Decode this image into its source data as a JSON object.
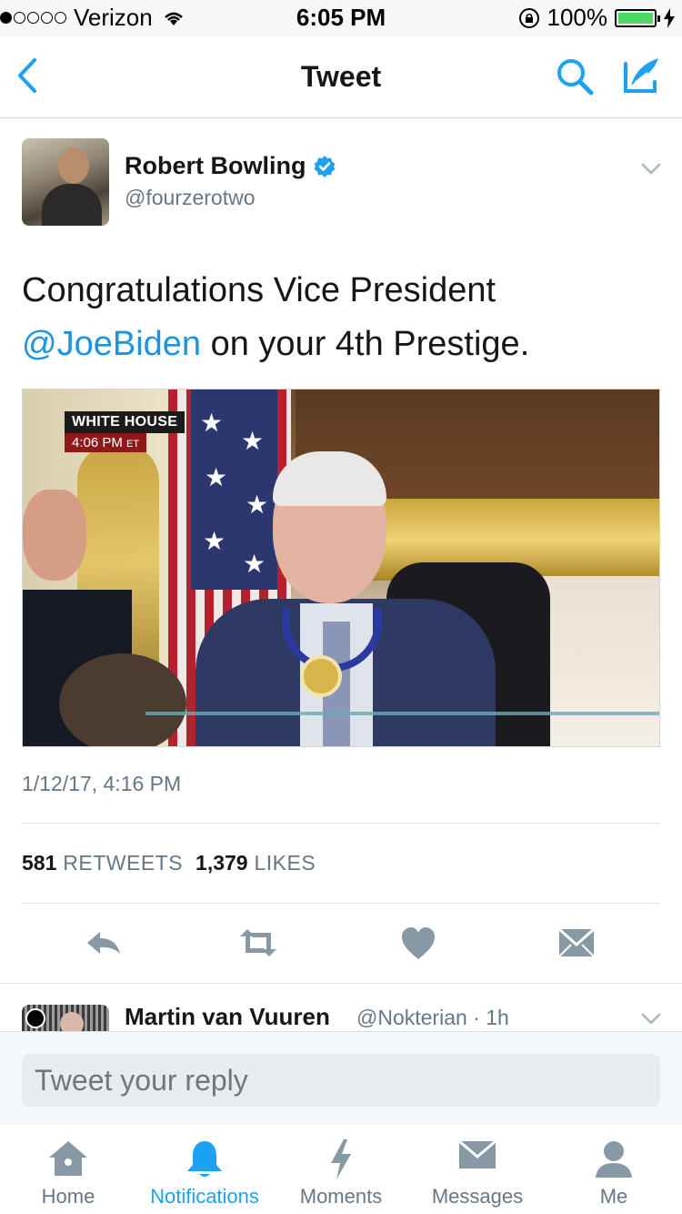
{
  "status_bar": {
    "carrier": "Verizon",
    "time": "6:05 PM",
    "battery": "100%",
    "signal_bars_filled": 1,
    "signal_bars_total": 5
  },
  "nav": {
    "title": "Tweet",
    "back_icon": "chevron-left-icon",
    "search_icon": "search-icon",
    "compose_icon": "compose-icon"
  },
  "tweet": {
    "author_name": "Robert Bowling",
    "author_handle": "@fourzerotwo",
    "verified": true,
    "text_line1": "Congratulations Vice President",
    "mention": "@JoeBiden",
    "text_line2_rest": " on your 4th Prestige.",
    "media": {
      "badge_line1": "WHITE HOUSE",
      "badge_time": "4:06 PM",
      "badge_tz": "ET"
    },
    "timestamp": "1/12/17, 4:16 PM",
    "retweets_count": "581",
    "retweets_label": "RETWEETS",
    "likes_count": "1,379",
    "likes_label": "LIKES"
  },
  "actions": [
    "reply-icon",
    "retweet-icon",
    "like-icon",
    "direct-message-icon"
  ],
  "reply_preview": {
    "name": "Martin van Vuuren",
    "handle_time": "@Nokterian · 1h"
  },
  "composer": {
    "placeholder": "Tweet your reply"
  },
  "tabs": [
    {
      "label": "Home",
      "icon": "home-icon",
      "active": false
    },
    {
      "label": "Notifications",
      "icon": "bell-icon",
      "active": true
    },
    {
      "label": "Moments",
      "icon": "lightning-icon",
      "active": false
    },
    {
      "label": "Messages",
      "icon": "envelope-icon",
      "active": false
    },
    {
      "label": "Me",
      "icon": "person-icon",
      "active": false
    }
  ],
  "colors": {
    "accent": "#1da1f2",
    "mention": "#1b95e0",
    "secondary_text": "#657786",
    "icon_gray": "#8899a6"
  }
}
